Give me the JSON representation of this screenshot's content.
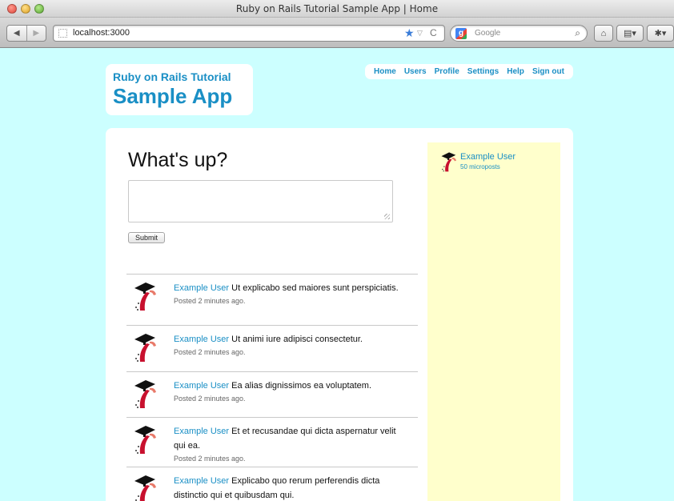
{
  "browser": {
    "window_title": "Ruby on Rails Tutorial Sample App | Home",
    "url": "localhost:3000",
    "search_placeholder": "Google"
  },
  "header": {
    "logo_line1": "Ruby on Rails Tutorial",
    "logo_line2": "Sample App"
  },
  "nav": {
    "items": [
      {
        "label": "Home"
      },
      {
        "label": "Users"
      },
      {
        "label": "Profile"
      },
      {
        "label": "Settings"
      },
      {
        "label": "Help"
      },
      {
        "label": "Sign out"
      }
    ]
  },
  "main": {
    "heading": "What's up?",
    "submit_label": "Submit"
  },
  "feed": {
    "items": [
      {
        "user": "Example User",
        "content": "Ut explicabo sed maiores sunt perspiciatis.",
        "timestamp": "Posted 2 minutes ago."
      },
      {
        "user": "Example User",
        "content": "Ut animi iure adipisci consectetur.",
        "timestamp": "Posted 2 minutes ago."
      },
      {
        "user": "Example User",
        "content": "Ea alias dignissimos ea voluptatem.",
        "timestamp": "Posted 2 minutes ago."
      },
      {
        "user": "Example User",
        "content": "Et et recusandae qui dicta aspernatur velit qui ea.",
        "timestamp": "Posted 2 minutes ago."
      },
      {
        "user": "Example User",
        "content": "Explicabo quo rerum perferendis dicta distinctio qui et quibusdam qui.",
        "timestamp": ""
      }
    ]
  },
  "sidebar": {
    "user_name": "Example User",
    "micropost_count": "50 microposts"
  },
  "icons": {
    "avatar": "rails-graduation-cap-icon"
  }
}
